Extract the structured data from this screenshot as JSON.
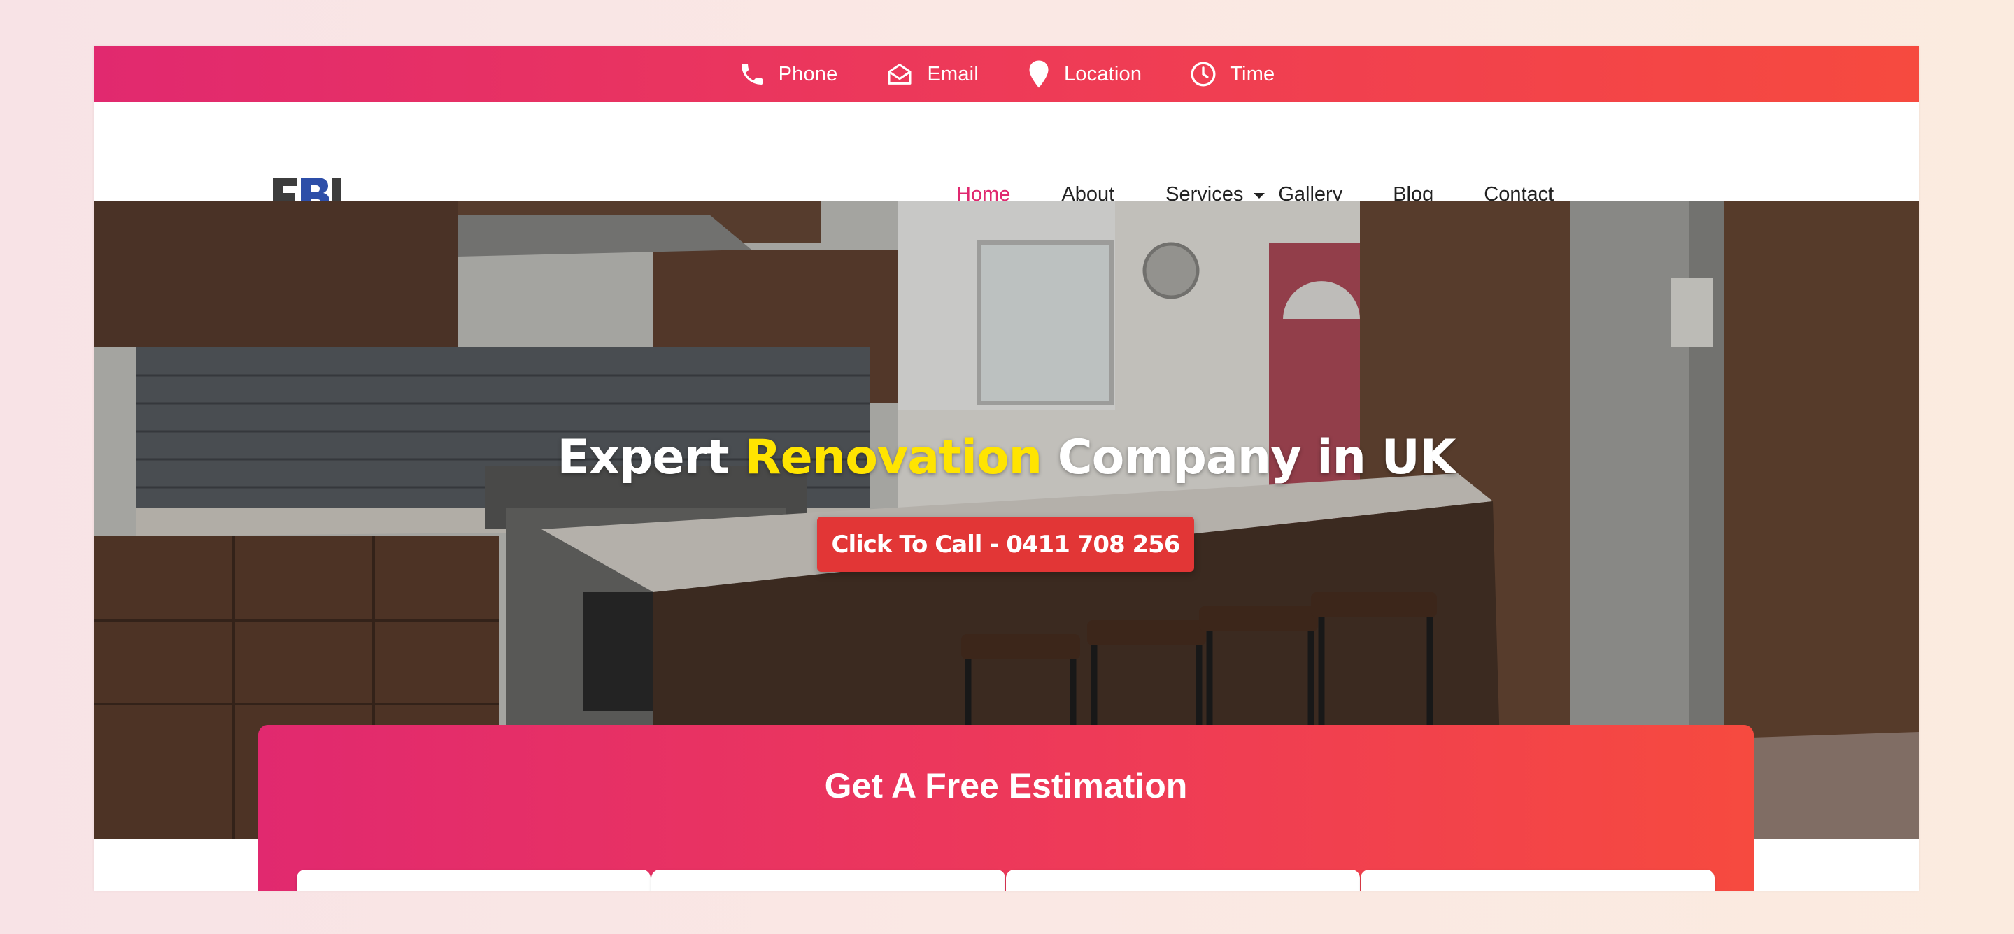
{
  "topbar": {
    "items": [
      {
        "label": "Phone",
        "icon": "phone-icon"
      },
      {
        "label": "Email",
        "icon": "envelope-open-icon"
      },
      {
        "label": "Location",
        "icon": "map-pin-icon"
      },
      {
        "label": "Time",
        "icon": "clock-icon"
      }
    ]
  },
  "brand": {
    "logo_text": "EBJ"
  },
  "nav": {
    "items": [
      {
        "label": "Home",
        "active": true
      },
      {
        "label": "About"
      },
      {
        "label": "Services",
        "has_dropdown": true
      },
      {
        "label": "Gallery"
      },
      {
        "label": "Blog"
      },
      {
        "label": "Contact"
      }
    ]
  },
  "hero": {
    "title_part1": "Expert ",
    "title_highlight": "Renovation",
    "title_part2": " Company in UK",
    "cta_label": "Click To Call - 0411 708 256"
  },
  "estimate": {
    "title": "Get A Free Estimation",
    "fields": [
      "",
      "",
      "",
      ""
    ]
  },
  "colors": {
    "accent_start": "#e1296f",
    "accent_end": "#f64a3f",
    "nav_active": "#e0286f",
    "highlight": "#ffe400",
    "cta": "#e23636"
  }
}
